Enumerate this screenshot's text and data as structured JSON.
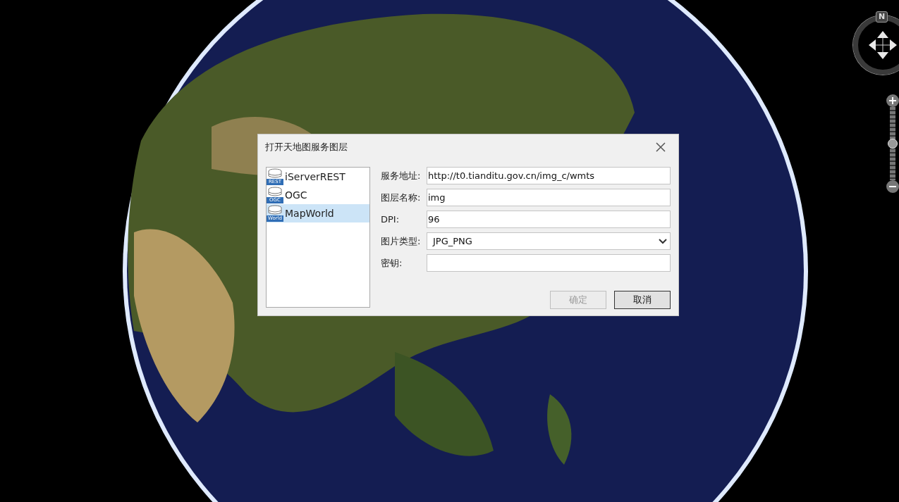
{
  "dialog": {
    "title": "打开天地图服务图层",
    "service_types": [
      {
        "label": "iServerREST",
        "badge": "REST",
        "selected": false
      },
      {
        "label": "OGC",
        "badge": "OGC",
        "selected": false
      },
      {
        "label": "MapWorld",
        "badge": "World",
        "selected": true
      }
    ],
    "fields": [
      {
        "kind": "text",
        "label": "服务地址:",
        "value": "http://t0.tianditu.gov.cn/img_c/wmts"
      },
      {
        "kind": "text",
        "label": "图层名称:",
        "value": "img"
      },
      {
        "kind": "text",
        "label": "DPI:",
        "value": "96"
      },
      {
        "kind": "select",
        "label": "图片类型:",
        "value": "JPG_PNG"
      },
      {
        "kind": "text",
        "label": "密钥:"
      }
    ],
    "buttons": [
      {
        "label": "确定",
        "disabled": true
      },
      {
        "label": "取消",
        "disabled": false
      }
    ]
  },
  "navigation": {
    "compass_label": "N",
    "zoom": {
      "level": 0.5
    }
  }
}
